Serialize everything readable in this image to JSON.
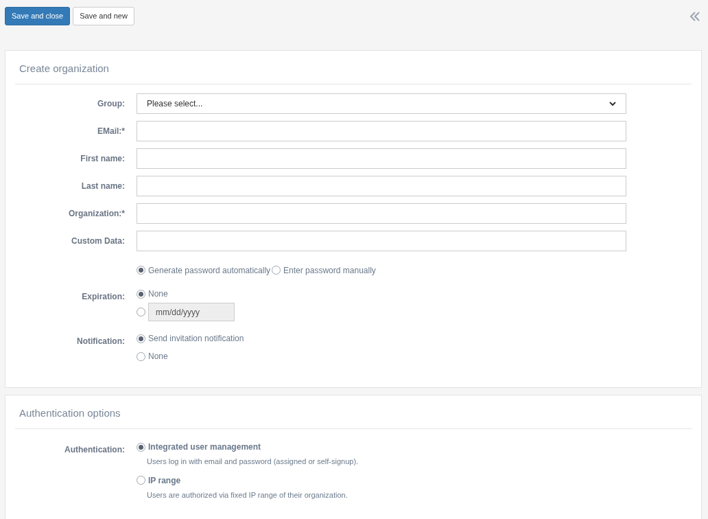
{
  "toolbar": {
    "buttons": [
      {
        "label": "Save and close",
        "kind": "primary"
      },
      {
        "label": "Save and new",
        "kind": "default"
      }
    ]
  },
  "sections": [
    {
      "title": "Create organization",
      "fields": [
        {
          "kind": "select",
          "label": "Group:",
          "value": "Please select..."
        },
        {
          "kind": "text",
          "label": "EMail:*"
        },
        {
          "kind": "text",
          "label": "First name:"
        },
        {
          "kind": "text",
          "label": "Last name:"
        },
        {
          "kind": "text",
          "label": "Organization:*"
        },
        {
          "kind": "text",
          "label": "Custom Data:"
        },
        {
          "kind": "radio_inline",
          "options": [
            {
              "label": "Generate password automatically",
              "selected": true
            },
            {
              "label": "Enter password manually",
              "selected": false
            }
          ]
        },
        {
          "kind": "radio_stack",
          "label": "Expiration:",
          "options": [
            {
              "label": "None",
              "selected": true
            },
            {
              "placeholder": "mm/dd/yyyy",
              "selected": false
            }
          ]
        },
        {
          "kind": "radio_stack",
          "label": "Notification:",
          "options": [
            {
              "label": "Send invitation notification",
              "selected": true
            },
            {
              "label": "None",
              "selected": false
            }
          ]
        }
      ]
    },
    {
      "title": "Authentication options",
      "fields": [
        {
          "kind": "radio_described",
          "label": "Authentication:",
          "options": [
            {
              "label": "Integrated user management",
              "description": "Users log in with email and password (assigned or self-signup).",
              "selected": true
            },
            {
              "label": "IP range",
              "description": "Users are authorized via fixed IP range of their organization.",
              "selected": false
            }
          ]
        }
      ]
    }
  ]
}
